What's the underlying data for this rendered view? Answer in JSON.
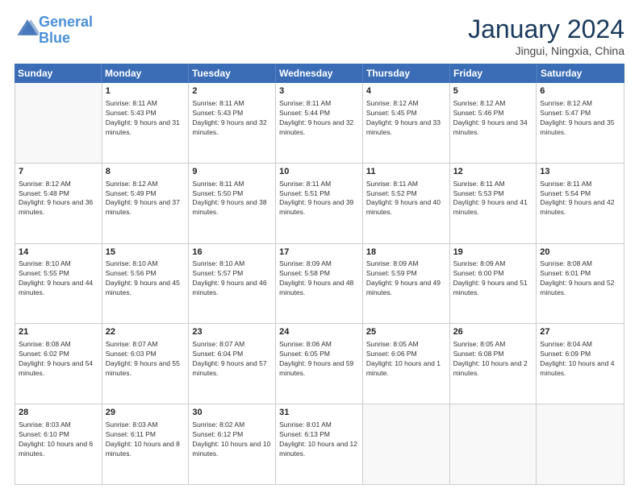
{
  "header": {
    "logo_line1": "General",
    "logo_line2": "Blue",
    "month": "January 2024",
    "location": "Jingui, Ningxia, China"
  },
  "days": [
    "Sunday",
    "Monday",
    "Tuesday",
    "Wednesday",
    "Thursday",
    "Friday",
    "Saturday"
  ],
  "rows": [
    [
      {
        "day": "",
        "empty": true
      },
      {
        "day": "1",
        "sunrise": "Sunrise: 8:11 AM",
        "sunset": "Sunset: 5:43 PM",
        "daylight": "Daylight: 9 hours and 31 minutes."
      },
      {
        "day": "2",
        "sunrise": "Sunrise: 8:11 AM",
        "sunset": "Sunset: 5:43 PM",
        "daylight": "Daylight: 9 hours and 32 minutes."
      },
      {
        "day": "3",
        "sunrise": "Sunrise: 8:11 AM",
        "sunset": "Sunset: 5:44 PM",
        "daylight": "Daylight: 9 hours and 32 minutes."
      },
      {
        "day": "4",
        "sunrise": "Sunrise: 8:12 AM",
        "sunset": "Sunset: 5:45 PM",
        "daylight": "Daylight: 9 hours and 33 minutes."
      },
      {
        "day": "5",
        "sunrise": "Sunrise: 8:12 AM",
        "sunset": "Sunset: 5:46 PM",
        "daylight": "Daylight: 9 hours and 34 minutes."
      },
      {
        "day": "6",
        "sunrise": "Sunrise: 8:12 AM",
        "sunset": "Sunset: 5:47 PM",
        "daylight": "Daylight: 9 hours and 35 minutes."
      }
    ],
    [
      {
        "day": "7",
        "sunrise": "Sunrise: 8:12 AM",
        "sunset": "Sunset: 5:48 PM",
        "daylight": "Daylight: 9 hours and 36 minutes."
      },
      {
        "day": "8",
        "sunrise": "Sunrise: 8:12 AM",
        "sunset": "Sunset: 5:49 PM",
        "daylight": "Daylight: 9 hours and 37 minutes."
      },
      {
        "day": "9",
        "sunrise": "Sunrise: 8:11 AM",
        "sunset": "Sunset: 5:50 PM",
        "daylight": "Daylight: 9 hours and 38 minutes."
      },
      {
        "day": "10",
        "sunrise": "Sunrise: 8:11 AM",
        "sunset": "Sunset: 5:51 PM",
        "daylight": "Daylight: 9 hours and 39 minutes."
      },
      {
        "day": "11",
        "sunrise": "Sunrise: 8:11 AM",
        "sunset": "Sunset: 5:52 PM",
        "daylight": "Daylight: 9 hours and 40 minutes."
      },
      {
        "day": "12",
        "sunrise": "Sunrise: 8:11 AM",
        "sunset": "Sunset: 5:53 PM",
        "daylight": "Daylight: 9 hours and 41 minutes."
      },
      {
        "day": "13",
        "sunrise": "Sunrise: 8:11 AM",
        "sunset": "Sunset: 5:54 PM",
        "daylight": "Daylight: 9 hours and 42 minutes."
      }
    ],
    [
      {
        "day": "14",
        "sunrise": "Sunrise: 8:10 AM",
        "sunset": "Sunset: 5:55 PM",
        "daylight": "Daylight: 9 hours and 44 minutes."
      },
      {
        "day": "15",
        "sunrise": "Sunrise: 8:10 AM",
        "sunset": "Sunset: 5:56 PM",
        "daylight": "Daylight: 9 hours and 45 minutes."
      },
      {
        "day": "16",
        "sunrise": "Sunrise: 8:10 AM",
        "sunset": "Sunset: 5:57 PM",
        "daylight": "Daylight: 9 hours and 46 minutes."
      },
      {
        "day": "17",
        "sunrise": "Sunrise: 8:09 AM",
        "sunset": "Sunset: 5:58 PM",
        "daylight": "Daylight: 9 hours and 48 minutes."
      },
      {
        "day": "18",
        "sunrise": "Sunrise: 8:09 AM",
        "sunset": "Sunset: 5:59 PM",
        "daylight": "Daylight: 9 hours and 49 minutes."
      },
      {
        "day": "19",
        "sunrise": "Sunrise: 8:09 AM",
        "sunset": "Sunset: 6:00 PM",
        "daylight": "Daylight: 9 hours and 51 minutes."
      },
      {
        "day": "20",
        "sunrise": "Sunrise: 8:08 AM",
        "sunset": "Sunset: 6:01 PM",
        "daylight": "Daylight: 9 hours and 52 minutes."
      }
    ],
    [
      {
        "day": "21",
        "sunrise": "Sunrise: 8:08 AM",
        "sunset": "Sunset: 6:02 PM",
        "daylight": "Daylight: 9 hours and 54 minutes."
      },
      {
        "day": "22",
        "sunrise": "Sunrise: 8:07 AM",
        "sunset": "Sunset: 6:03 PM",
        "daylight": "Daylight: 9 hours and 55 minutes."
      },
      {
        "day": "23",
        "sunrise": "Sunrise: 8:07 AM",
        "sunset": "Sunset: 6:04 PM",
        "daylight": "Daylight: 9 hours and 57 minutes."
      },
      {
        "day": "24",
        "sunrise": "Sunrise: 8:06 AM",
        "sunset": "Sunset: 6:05 PM",
        "daylight": "Daylight: 9 hours and 59 minutes."
      },
      {
        "day": "25",
        "sunrise": "Sunrise: 8:05 AM",
        "sunset": "Sunset: 6:06 PM",
        "daylight": "Daylight: 10 hours and 1 minute."
      },
      {
        "day": "26",
        "sunrise": "Sunrise: 8:05 AM",
        "sunset": "Sunset: 6:08 PM",
        "daylight": "Daylight: 10 hours and 2 minutes."
      },
      {
        "day": "27",
        "sunrise": "Sunrise: 8:04 AM",
        "sunset": "Sunset: 6:09 PM",
        "daylight": "Daylight: 10 hours and 4 minutes."
      }
    ],
    [
      {
        "day": "28",
        "sunrise": "Sunrise: 8:03 AM",
        "sunset": "Sunset: 6:10 PM",
        "daylight": "Daylight: 10 hours and 6 minutes."
      },
      {
        "day": "29",
        "sunrise": "Sunrise: 8:03 AM",
        "sunset": "Sunset: 6:11 PM",
        "daylight": "Daylight: 10 hours and 8 minutes."
      },
      {
        "day": "30",
        "sunrise": "Sunrise: 8:02 AM",
        "sunset": "Sunset: 6:12 PM",
        "daylight": "Daylight: 10 hours and 10 minutes."
      },
      {
        "day": "31",
        "sunrise": "Sunrise: 8:01 AM",
        "sunset": "Sunset: 6:13 PM",
        "daylight": "Daylight: 10 hours and 12 minutes."
      },
      {
        "day": "",
        "empty": true
      },
      {
        "day": "",
        "empty": true
      },
      {
        "day": "",
        "empty": true
      }
    ]
  ]
}
